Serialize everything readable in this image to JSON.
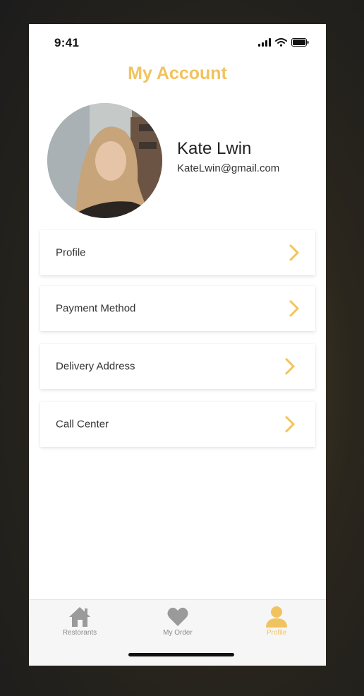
{
  "status_bar": {
    "time": "9:41"
  },
  "header": {
    "title": "My Account"
  },
  "user": {
    "name": "Kate Lwin",
    "email": "KateLwin@gmail.com"
  },
  "menu": {
    "items": [
      {
        "label": "Profile"
      },
      {
        "label": "Payment Method"
      },
      {
        "label": "Delivery Address"
      },
      {
        "label": "Call Center"
      }
    ]
  },
  "tab_bar": {
    "tabs": [
      {
        "label": "Restorants",
        "icon": "house-icon",
        "active": false
      },
      {
        "label": "My Order",
        "icon": "heart-icon",
        "active": false
      },
      {
        "label": "Profile",
        "icon": "person-icon",
        "active": true
      }
    ]
  },
  "colors": {
    "accent": "#f1c35f",
    "inactive": "#8a8a8a"
  }
}
